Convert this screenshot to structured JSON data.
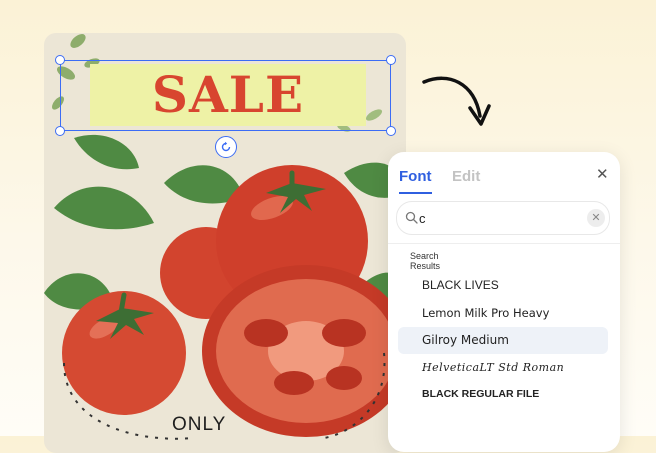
{
  "poster": {
    "headline": "SALE",
    "footer_text": "ONLY"
  },
  "font_panel": {
    "tabs": [
      {
        "label": "Font",
        "active": true
      },
      {
        "label": "Edit",
        "active": false
      }
    ],
    "close_icon": "close-icon",
    "search": {
      "value": "c",
      "icon": "search-icon",
      "clear_icon": "clear-icon"
    },
    "results_label": "Search Results",
    "results": [
      {
        "name": "BLACK LIVES",
        "selected": false
      },
      {
        "name": "Lemon Milk Pro Heavy",
        "selected": false
      },
      {
        "name": "Gilroy Medium",
        "selected": true
      },
      {
        "name": "HelveticaLT Std Roman",
        "selected": false
      },
      {
        "name": "BLACK REGULAR FILE",
        "selected": false
      }
    ]
  },
  "colors": {
    "accent": "#3b6cf5",
    "tab_active": "#2f5fe0",
    "sale_text": "#d8452f",
    "sale_highlight": "#eef2a6"
  }
}
